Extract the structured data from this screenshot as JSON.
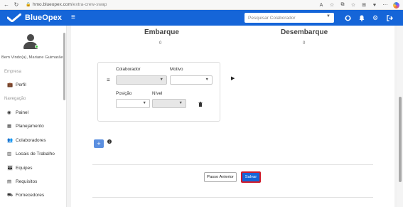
{
  "browser": {
    "url_host": "hmo.blueopex.com",
    "url_path": "/extra-crew-swap"
  },
  "header": {
    "brand": "BlueOpex",
    "search_placeholder": "Pesquisar Colaborador",
    "colors": {
      "primary": "#1565d8"
    }
  },
  "sidebar": {
    "welcome": "Bem Vindo(a), Mariane Guimarães",
    "section_empresa": "Empresa",
    "section_navegacao": "Navegação",
    "items": [
      {
        "label": "Perfil",
        "icon": "briefcase-icon"
      },
      {
        "label": "Painel",
        "icon": "dashboard-icon"
      },
      {
        "label": "Planejamento",
        "icon": "calendar-icon"
      },
      {
        "label": "Colaboradores",
        "icon": "users-icon"
      },
      {
        "label": "Locais de Trabalho",
        "icon": "building-icon"
      },
      {
        "label": "Equipes",
        "icon": "team-icon"
      },
      {
        "label": "Requisitos",
        "icon": "clipboard-icon"
      },
      {
        "label": "Fornecedores",
        "icon": "truck-icon"
      }
    ]
  },
  "main": {
    "embarque_title": "Embarque",
    "embarque_count": "0",
    "desembarque_title": "Desembarque",
    "desembarque_count": "0",
    "form": {
      "colaborador_label": "Colaborador",
      "motivo_label": "Motivo",
      "posicao_label": "Posição",
      "nivel_label": "Nível"
    },
    "buttons": {
      "prev": "Passo Anterior",
      "save": "Salvar",
      "add": "+"
    }
  }
}
